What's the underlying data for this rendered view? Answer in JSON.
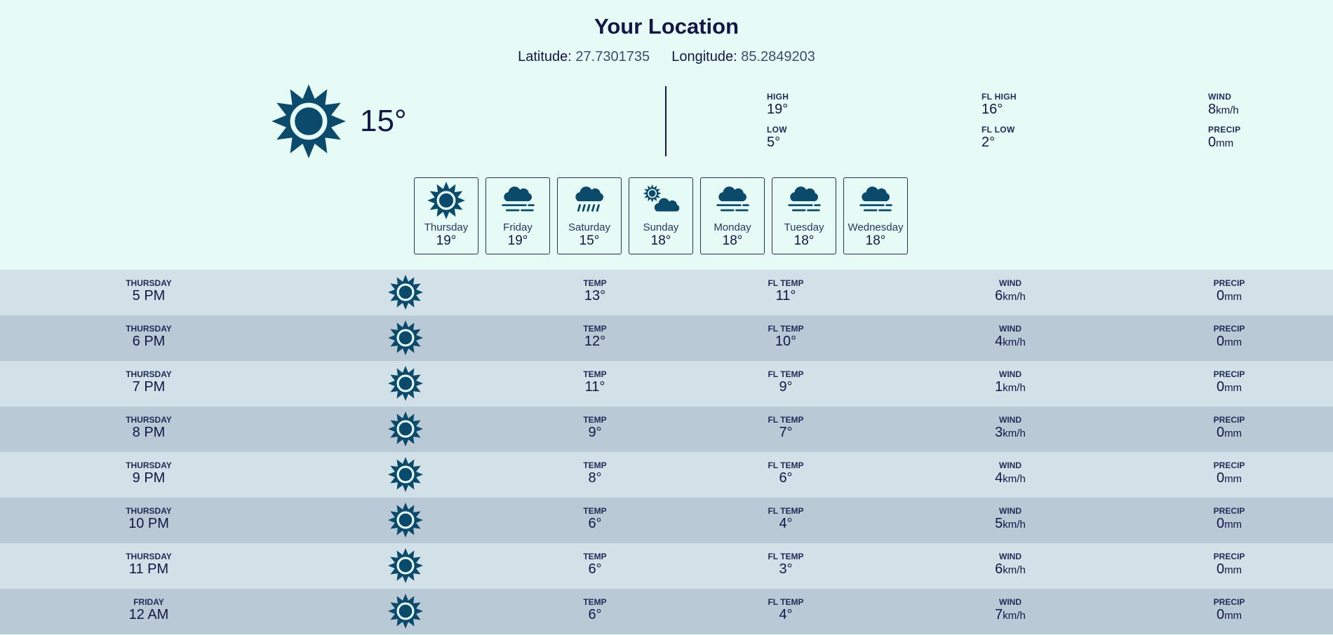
{
  "location": {
    "title": "Your Location",
    "latitude_label": "Latitude:",
    "latitude": "27.7301735",
    "longitude_label": "Longitude:",
    "longitude": "85.2849203"
  },
  "current": {
    "temp": "15°",
    "icon": "sun-icon",
    "high_label": "HIGH",
    "high": "19°",
    "low_label": "LOW",
    "low": "5°",
    "fl_high_label": "FL HIGH",
    "fl_high": "16°",
    "fl_low_label": "FL LOW",
    "fl_low": "2°",
    "wind_label": "WIND",
    "wind": "8",
    "wind_unit": "km/h",
    "precip_label": "PRECIP",
    "precip": "0",
    "precip_unit": "mm"
  },
  "daily": [
    {
      "day": "Thursday",
      "temp": "19°",
      "icon": "sun-icon"
    },
    {
      "day": "Friday",
      "temp": "19°",
      "icon": "fog-icon"
    },
    {
      "day": "Saturday",
      "temp": "15°",
      "icon": "rain-icon"
    },
    {
      "day": "Sunday",
      "temp": "18°",
      "icon": "partly-cloudy-icon"
    },
    {
      "day": "Monday",
      "temp": "18°",
      "icon": "fog-icon"
    },
    {
      "day": "Tuesday",
      "temp": "18°",
      "icon": "fog-icon"
    },
    {
      "day": "Wednesday",
      "temp": "18°",
      "icon": "fog-icon"
    }
  ],
  "hourly_labels": {
    "temp": "TEMP",
    "fl_temp": "FL TEMP",
    "wind": "WIND",
    "precip": "PRECIP",
    "wind_unit": "km/h",
    "precip_unit": "mm"
  },
  "hourly": [
    {
      "day": "THURSDAY",
      "time": "5 PM",
      "temp": "13°",
      "fl_temp": "11°",
      "wind": "6",
      "precip": "0",
      "icon": "sun-icon"
    },
    {
      "day": "THURSDAY",
      "time": "6 PM",
      "temp": "12°",
      "fl_temp": "10°",
      "wind": "4",
      "precip": "0",
      "icon": "sun-icon"
    },
    {
      "day": "THURSDAY",
      "time": "7 PM",
      "temp": "11°",
      "fl_temp": "9°",
      "wind": "1",
      "precip": "0",
      "icon": "sun-icon"
    },
    {
      "day": "THURSDAY",
      "time": "8 PM",
      "temp": "9°",
      "fl_temp": "7°",
      "wind": "3",
      "precip": "0",
      "icon": "sun-icon"
    },
    {
      "day": "THURSDAY",
      "time": "9 PM",
      "temp": "8°",
      "fl_temp": "6°",
      "wind": "4",
      "precip": "0",
      "icon": "sun-icon"
    },
    {
      "day": "THURSDAY",
      "time": "10 PM",
      "temp": "6°",
      "fl_temp": "4°",
      "wind": "5",
      "precip": "0",
      "icon": "sun-icon"
    },
    {
      "day": "THURSDAY",
      "time": "11 PM",
      "temp": "6°",
      "fl_temp": "3°",
      "wind": "6",
      "precip": "0",
      "icon": "sun-icon"
    },
    {
      "day": "FRIDAY",
      "time": "12 AM",
      "temp": "6°",
      "fl_temp": "4°",
      "wind": "7",
      "precip": "0",
      "icon": "sun-icon"
    }
  ],
  "colors": {
    "page_bg": "#e6fbf6",
    "icon": "#0b4a6b",
    "row_light": "#d1e1e7",
    "row_dark": "#b9c9d6",
    "text": "#141645"
  }
}
